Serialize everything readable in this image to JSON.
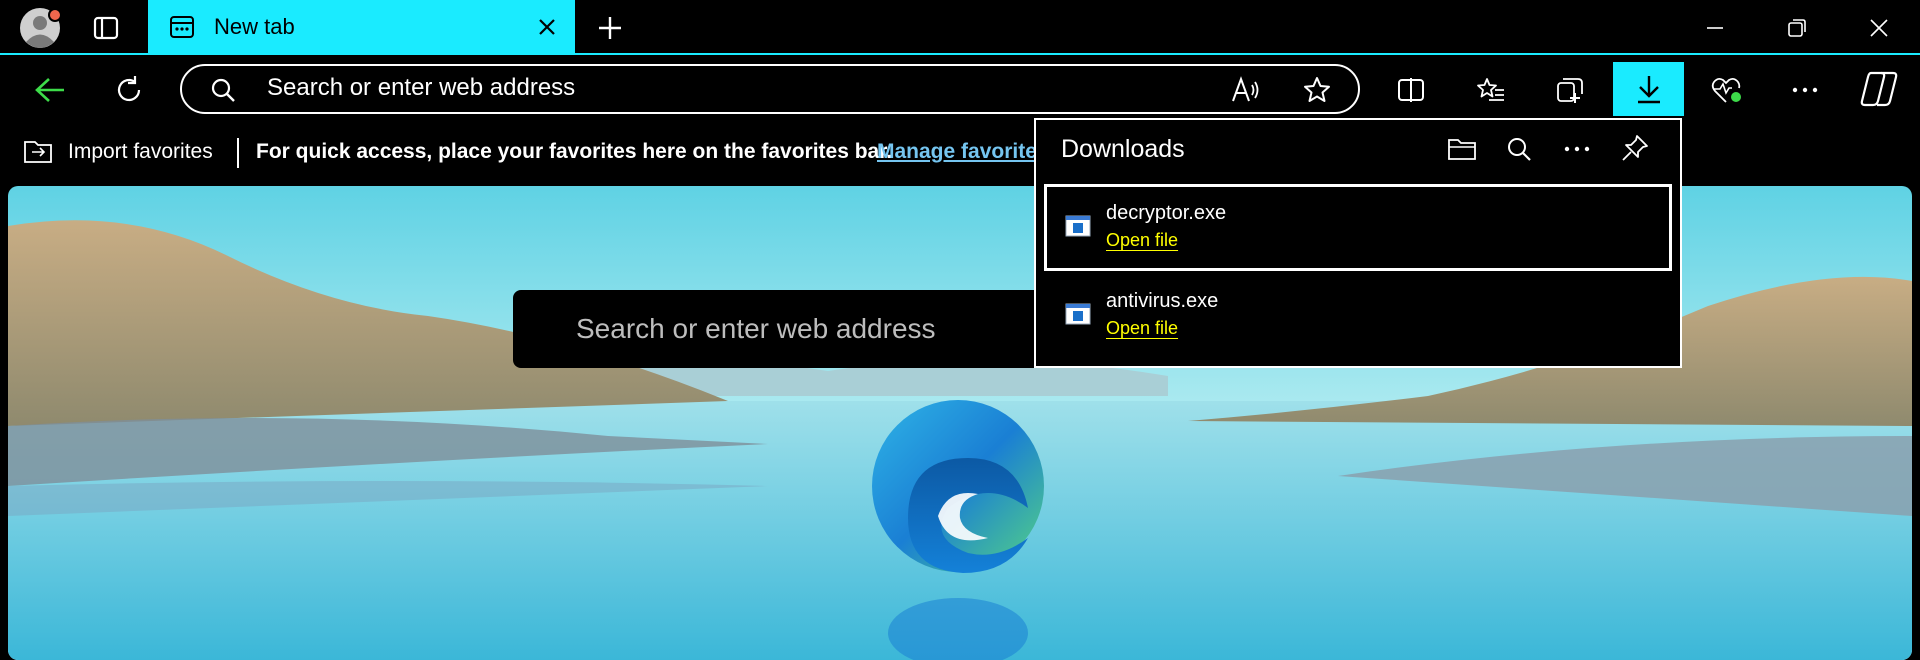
{
  "tab": {
    "title": "New tab"
  },
  "toolbar": {
    "address_placeholder": "Search or enter web address"
  },
  "favorites_bar": {
    "import_label": "Import favorites",
    "hint": "For quick access, place your favorites here on the favorites bar.",
    "manage_link": "Manage favorite"
  },
  "page": {
    "search_placeholder": "Search or enter web address"
  },
  "downloads": {
    "title": "Downloads",
    "items": [
      {
        "name": "decryptor.exe",
        "action": "Open file"
      },
      {
        "name": "antivirus.exe",
        "action": "Open file"
      }
    ]
  },
  "colors": {
    "accent": "#1aebff",
    "link": "#75c5f0",
    "open_link": "#ffff00",
    "back_arrow": "#3ddc4a"
  },
  "icons": [
    "profile-avatar",
    "tab-actions-icon",
    "new-tab-page-icon",
    "close-icon",
    "plus-icon",
    "minimize-icon",
    "restore-icon",
    "window-close-icon",
    "back-icon",
    "refresh-icon",
    "search-icon",
    "read-aloud-icon",
    "star-icon",
    "split-screen-icon",
    "favorites-icon",
    "collections-icon",
    "download-icon",
    "browser-essentials-icon",
    "more-icon",
    "copilot-icon",
    "import-icon",
    "folder-icon",
    "pin-icon",
    "exe-file-icon",
    "edge-logo"
  ]
}
